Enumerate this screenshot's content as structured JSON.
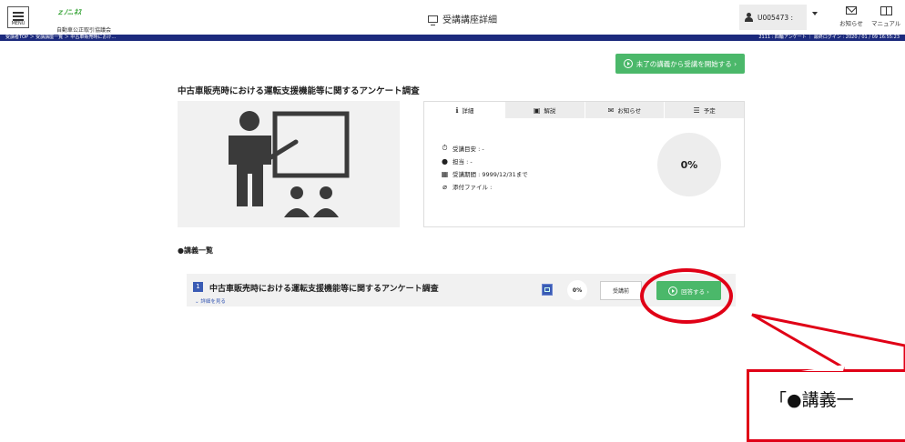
{
  "header": {
    "menu_label": "MENU",
    "logo_mark": "ｚﾉﾆ.ﾈｽ",
    "org_name": "自動車公正取引協議会",
    "title": "受講講座詳細",
    "user_id": "U005473 :",
    "notifications_label": "お知らせ",
    "manual_label": "マニュアル"
  },
  "navbar": {
    "breadcrumb": "受講者TOP ＞ 受講講座一覧 ＞ 中古車販売時におけ…",
    "right_info": "2111 : 四輪アンケート ｜ 最終ログイン : 2020 / 01 / 09 16:55:23"
  },
  "actions": {
    "start_label": "未了の講義から受講を開始する ›"
  },
  "course": {
    "title": "中古車販売時における運転支援機能等に関するアンケート調査",
    "tabs": [
      {
        "label": "詳細",
        "icon": "info-icon"
      },
      {
        "label": "解説",
        "icon": "document-icon"
      },
      {
        "label": "お知らせ",
        "icon": "mail-icon"
      },
      {
        "label": "予定",
        "icon": "list-icon"
      }
    ],
    "info": {
      "duration": "受講目安 : -",
      "instructor": "担当 : -",
      "period": "受講期間 : 9999/12/31まで",
      "attachments": "添付ファイル :"
    },
    "progress": "0%"
  },
  "lecture_list": {
    "heading": "●講義一覧",
    "items": [
      {
        "number": "1",
        "title": "中古車販売時における運転支援機能等に関するアンケート調査",
        "detail_link": "詳細を見る",
        "progress": "0%",
        "status": "受講前",
        "answer_label": "回答する ›"
      }
    ]
  },
  "annotation": {
    "callout_text": "「●講義一",
    "color": "#e00016"
  },
  "colors": {
    "navbar": "#1c2a7d",
    "button_green": "#4bb86a",
    "badge_blue": "#3a5bb4"
  }
}
